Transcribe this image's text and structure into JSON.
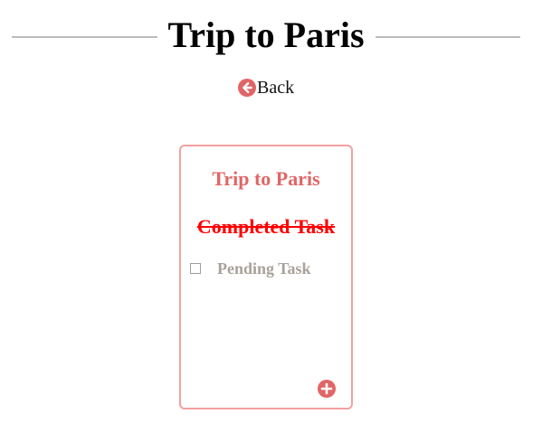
{
  "header": {
    "title": "Trip to Paris"
  },
  "nav": {
    "back_label": "Back",
    "back_icon": "arrow-left-circle-icon"
  },
  "list": {
    "title": "Trip to Paris",
    "tasks": [
      {
        "label": "Completed Task",
        "completed": true
      },
      {
        "label": "Pending Task",
        "completed": false
      }
    ],
    "add_icon": "plus-circle-icon"
  },
  "colors": {
    "accent": "#e06666",
    "card_border": "#f4a0a0",
    "completed_text": "#ff0000",
    "pending_text": "#a8a29a",
    "header_rule": "#bdbdbd"
  }
}
